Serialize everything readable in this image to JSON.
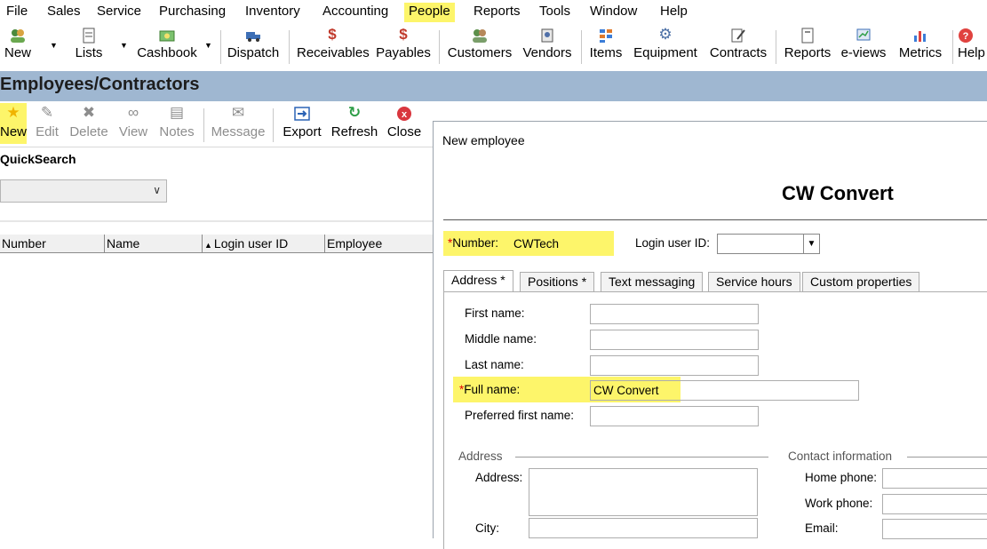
{
  "menubar": {
    "items": [
      "File",
      "Sales",
      "Service",
      "Purchasing",
      "Inventory",
      "Accounting",
      "People",
      "Reports",
      "Tools",
      "Window",
      "Help"
    ]
  },
  "toolbar": {
    "buttons": [
      "New",
      "Lists",
      "Cashbook",
      "Dispatch",
      "Receivables",
      "Payables",
      "Customers",
      "Vendors",
      "Items",
      "Equipment",
      "Contracts",
      "Reports",
      "e-views",
      "Metrics",
      "Help"
    ]
  },
  "page": {
    "title": "Employees/Contractors"
  },
  "list_toolbar": {
    "buttons": [
      "New",
      "Edit",
      "Delete",
      "View",
      "Notes",
      "Message",
      "Export",
      "Refresh",
      "Close"
    ]
  },
  "quicksearch": {
    "label": "QuickSearch",
    "value": ""
  },
  "grid": {
    "columns": [
      "Number",
      "Name",
      "Login user ID",
      "Employee"
    ]
  },
  "dialog": {
    "title": "New employee",
    "heading": "CW Convert",
    "number_label": "Number:",
    "number_value": "CWTech",
    "login_label": "Login user ID:",
    "login_value": "",
    "tabs": [
      "Address *",
      "Positions *",
      "Text messaging",
      "Service hours",
      "Custom properties"
    ],
    "fields": {
      "first_name": {
        "label": "First name:",
        "value": ""
      },
      "middle_name": {
        "label": "Middle name:",
        "value": ""
      },
      "last_name": {
        "label": "Last name:",
        "value": ""
      },
      "full_name": {
        "label": "Full name:",
        "value": "CW Convert"
      },
      "preferred_first_name": {
        "label": "Preferred first name:",
        "value": ""
      }
    },
    "address_group": {
      "title": "Address",
      "address_label": "Address:",
      "city_label": "City:"
    },
    "contact_group": {
      "title": "Contact information",
      "home_phone_label": "Home phone:",
      "work_phone_label": "Work phone:",
      "email_label": "Email:"
    }
  },
  "colors": {
    "highlight": "#fdf56a",
    "title_band": "#9fb7d1",
    "required": "#e00000"
  }
}
